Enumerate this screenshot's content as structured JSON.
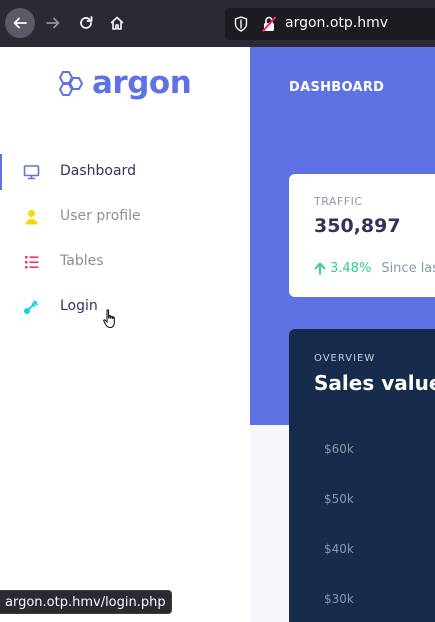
{
  "browser": {
    "url": "argon.otp.hmv",
    "status_url": "argon.otp.hmv/login.php"
  },
  "sidebar": {
    "brand": "argon",
    "items": [
      {
        "label": "Dashboard",
        "icon": "tv-icon",
        "color": "#5e72e4",
        "active": true
      },
      {
        "label": "User profile",
        "icon": "user-icon",
        "color": "#ffd600",
        "active": false
      },
      {
        "label": "Tables",
        "icon": "list-icon",
        "color": "#f5365c",
        "active": false
      },
      {
        "label": "Login",
        "icon": "key-icon",
        "color": "#11cdef",
        "active": false
      }
    ]
  },
  "main": {
    "page_title": "DASHBOARD",
    "traffic": {
      "label": "TRAFFIC",
      "value": "350,897",
      "change": "3.48%",
      "since": "Since last"
    },
    "overview": {
      "label": "OVERVIEW",
      "title": "Sales value",
      "y_ticks": [
        "$60k",
        "$50k",
        "$40k",
        "$30k"
      ]
    }
  },
  "colors": {
    "accent": "#5e72e4",
    "dark_card": "#172b4d",
    "success": "#2dce89"
  }
}
